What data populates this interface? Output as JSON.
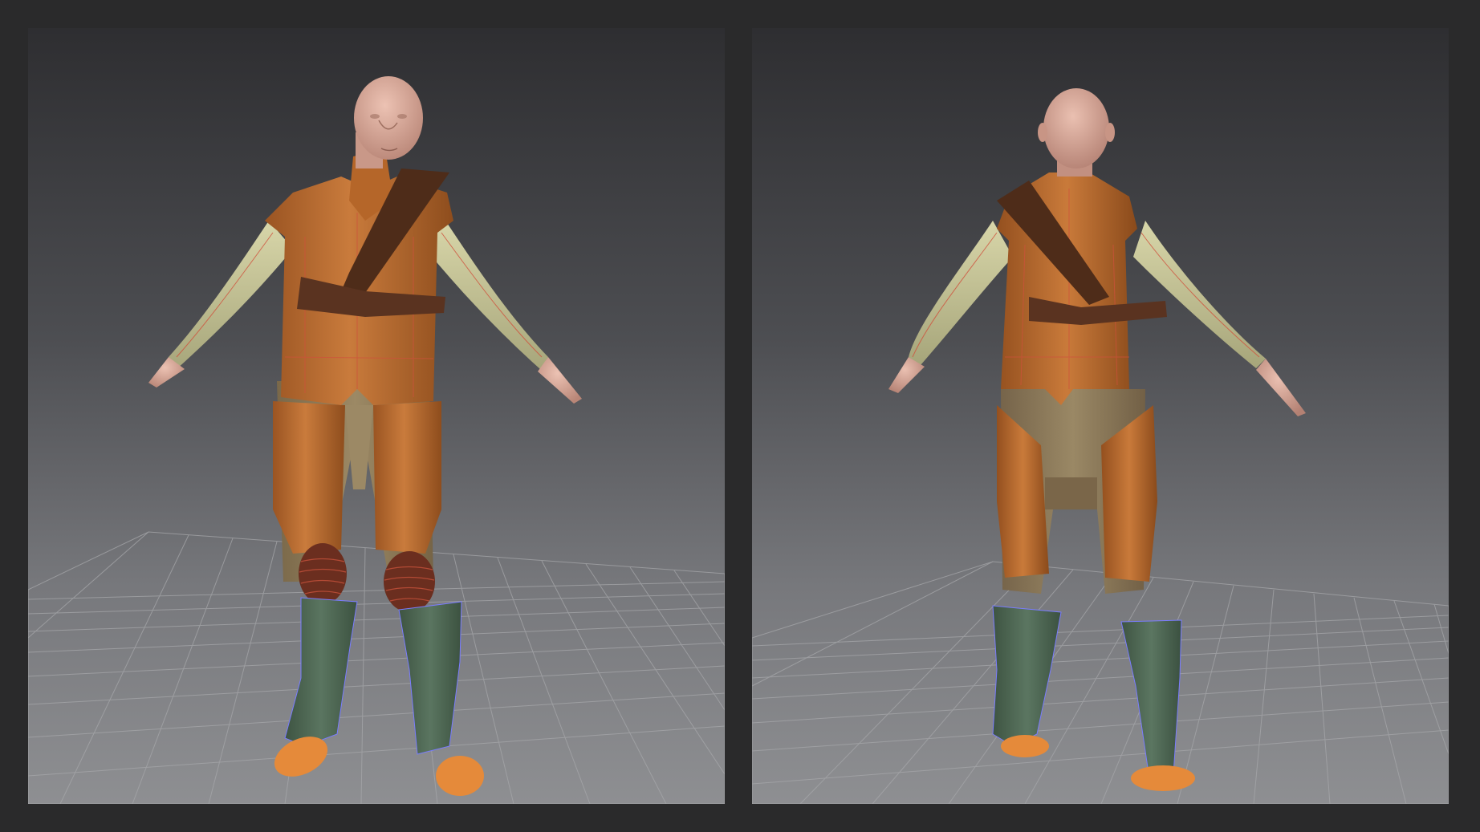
{
  "workspace": {
    "background": "#2a2a2b",
    "viewport_gradient": [
      "#2e2e31",
      "#8e8f92"
    ]
  },
  "viewports": [
    {
      "view": "front",
      "grid": true
    },
    {
      "view": "back",
      "grid": true
    }
  ],
  "garment_colors": {
    "skin": "#d9a898",
    "vest_leather": "#b96a2d",
    "strap": "#4e2c19",
    "shirt": "#c9c79a",
    "trousers": "#8f7b5c",
    "boots": "#4d6650",
    "shoes": "#e58a3a",
    "knee_pads": "#6b2e1f",
    "seam_lines": "#d0503c",
    "selected_outline": "#7a7cff"
  }
}
